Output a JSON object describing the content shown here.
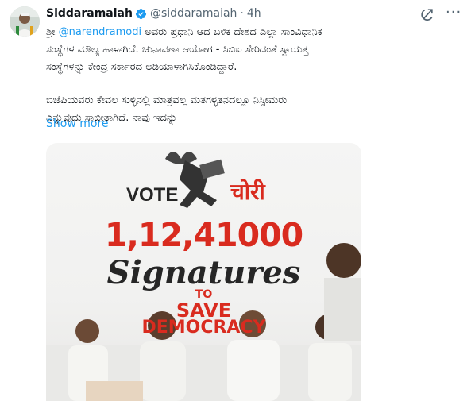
{
  "tweet": {
    "author_name": "Siddaramaiah",
    "handle": "@siddaramaiah",
    "separator": "·",
    "time": "4h",
    "more_label": "···",
    "text_line1_prefix": "ಶ್ರೀ ",
    "mention": "@narendramodi",
    "text_line1_suffix": " ಅವರು ಪ್ರಧಾನಿ ಆದ ಬಳಿಕ ದೇಶದ ಎಲ್ಲಾ ಸಾಂವಿಧಾನಿಕ",
    "text_line2": "ಸಂಸ್ಥೆಗಳ ಮೌಲ್ಯ ಹಾಳಾಗಿದೆ. ಚುನಾವಣಾ ಆಯೋಗ - ಸಿಬಿಐ ಸೇರಿದಂತೆ ಸ್ವಾಯತ್ತ",
    "text_line3": "ಸಂಸ್ಥೆಗಳನ್ನು ಕೇಂದ್ರ ಸರ್ಕಾರದ ಅಡಿಯಾಳಾಗಿಸಿಕೊಂಡಿದ್ದಾರೆ.",
    "text_line4": "ಬಿಜೆಪಿಯವರು ಕೇವಲ ಸುಳ್ಳಿನಲ್ಲಿ ಮಾತ್ರವಲ್ಲ ಮತಗಳ್ಳತನದಲ್ಲೂ ನಿಸ್ಸೀಮರು",
    "text_line5": "ಎನ್ನುವುದು ಸಾಬೀತಾಗಿದೆ. ನಾವು ಇದನ್ನು",
    "show_more": "Show more"
  },
  "poster": {
    "vote": "VOTE",
    "chori": "चोरी",
    "number": "1,12,41000",
    "signatures": "Signatures",
    "to": "TO",
    "save": "SAVE",
    "democracy": "DEMOCRACY"
  },
  "colors": {
    "accent": "#1d9bf0",
    "poster_red": "#d92b1f",
    "text": "#0f1419",
    "muted": "#536471"
  },
  "icons": [
    "verified-badge-icon",
    "grok-icon",
    "more-options-icon"
  ]
}
